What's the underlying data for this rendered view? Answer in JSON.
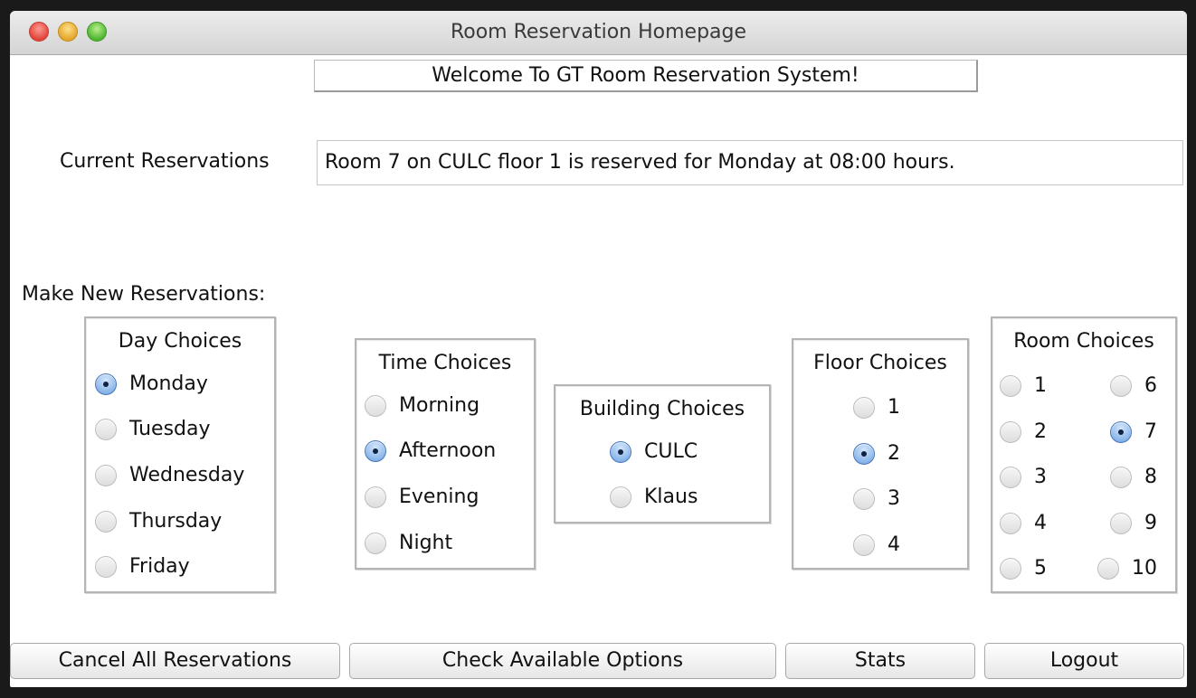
{
  "window": {
    "title": "Room Reservation Homepage"
  },
  "welcome": "Welcome To GT Room Reservation System!",
  "current_reservations": {
    "label": "Current Reservations",
    "value": "Room 7 on CULC floor 1 is reserved for Monday at 08:00 hours."
  },
  "make_new_label": "Make New Reservations:",
  "day": {
    "title": "Day Choices",
    "options": [
      "Monday",
      "Tuesday",
      "Wednesday",
      "Thursday",
      "Friday"
    ],
    "selected": "Monday"
  },
  "time": {
    "title": "Time Choices",
    "options": [
      "Morning",
      "Afternoon",
      "Evening",
      "Night"
    ],
    "selected": "Afternoon"
  },
  "building": {
    "title": "Building Choices",
    "options": [
      "CULC",
      "Klaus"
    ],
    "selected": "CULC"
  },
  "floor": {
    "title": "Floor Choices",
    "options": [
      "1",
      "2",
      "3",
      "4"
    ],
    "selected": "2"
  },
  "room": {
    "title": "Room Choices",
    "options": [
      "1",
      "2",
      "3",
      "4",
      "5",
      "6",
      "7",
      "8",
      "9",
      "10"
    ],
    "selected": "7"
  },
  "buttons": {
    "cancel_all": "Cancel All Reservations",
    "check_options": "Check Available Options",
    "stats": "Stats",
    "logout": "Logout"
  },
  "colors": {
    "radio_selected": "#8ab6ea",
    "window_bg": "#ffffff",
    "titlebar": "#dcdcdc"
  }
}
